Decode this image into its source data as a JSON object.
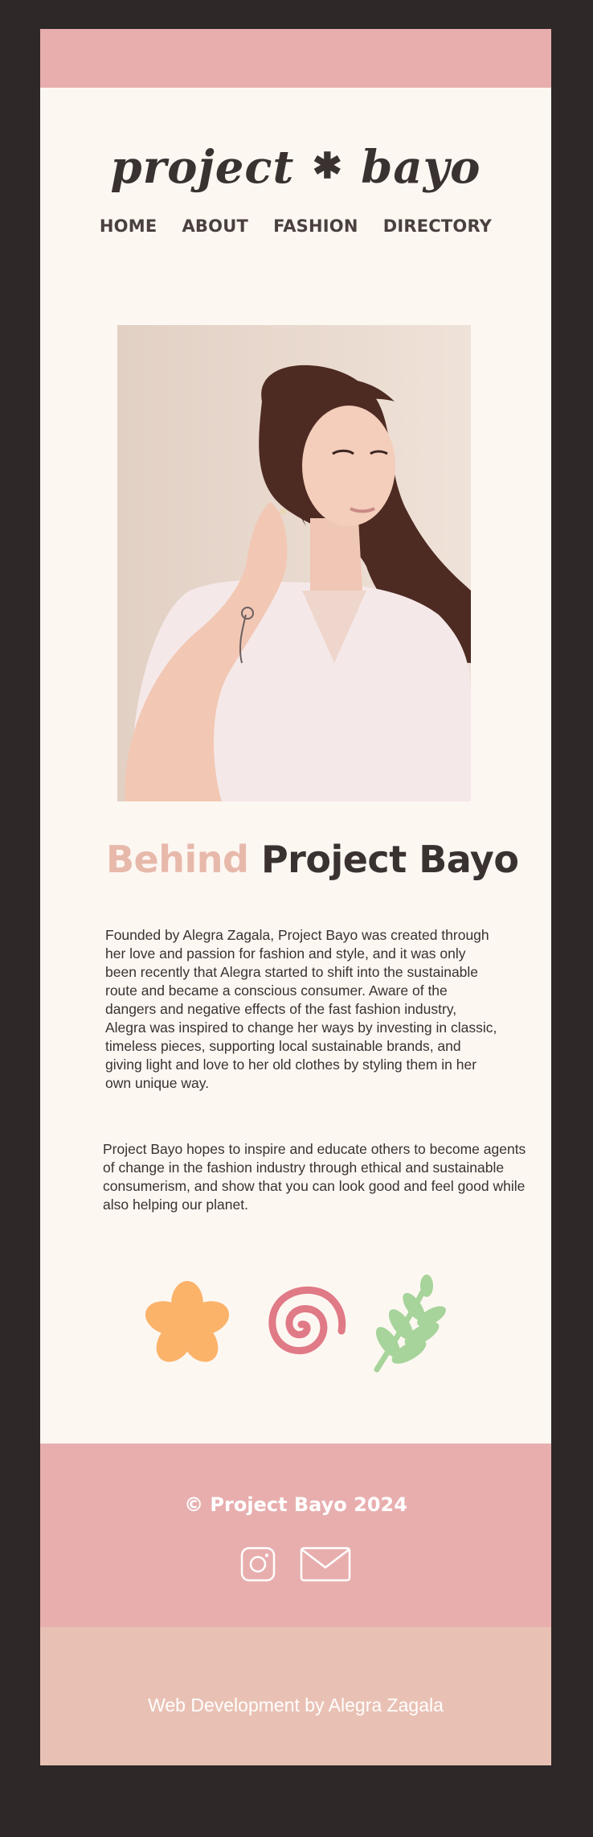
{
  "brand": {
    "logo_part1": "project",
    "logo_star": "✱",
    "logo_part2": "bayo"
  },
  "nav": {
    "items": [
      {
        "label": "HOME"
      },
      {
        "label": "ABOUT"
      },
      {
        "label": "FASHION"
      },
      {
        "label": "DIRECTORY"
      }
    ]
  },
  "about": {
    "heading_accent": "Behind",
    "heading_main": "Project Bayo",
    "paragraph1": "Founded by Alegra Zagala, Project Bayo was created through her love and passion for fashion and style, and it was only been recently that Alegra started to shift into the sustainable route and became a conscious consumer. Aware of the dangers and negative effects of the fast fashion industry, Alegra was inspired to change her ways by investing in classic, timeless pieces, supporting local sustainable brands, and giving light and love to her old clothes by styling them in her own unique way.",
    "paragraph2": "Project Bayo hopes to inspire and educate others to become agents of change in the fashion industry through ethical and sustainable consumerism, and show that you can look good and feel good while also helping our planet."
  },
  "decor": {
    "icons": [
      "flower-icon",
      "spiral-icon",
      "leaf-icon"
    ],
    "colors": {
      "flower": "#fbb36a",
      "spiral": "#e07a86",
      "leaf": "#a6d49a"
    }
  },
  "footer": {
    "copyright": "© Project Bayo 2024",
    "social_icons": [
      "instagram-icon",
      "mail-icon"
    ],
    "credit": "Web Development by Alegra Zagala"
  },
  "colors": {
    "background": "#2e2828",
    "page": "#fdf7f2",
    "pink": "#e8aeae",
    "peach": "#e9c1b4",
    "text": "#3a3131",
    "accent": "#e7b9ab"
  }
}
